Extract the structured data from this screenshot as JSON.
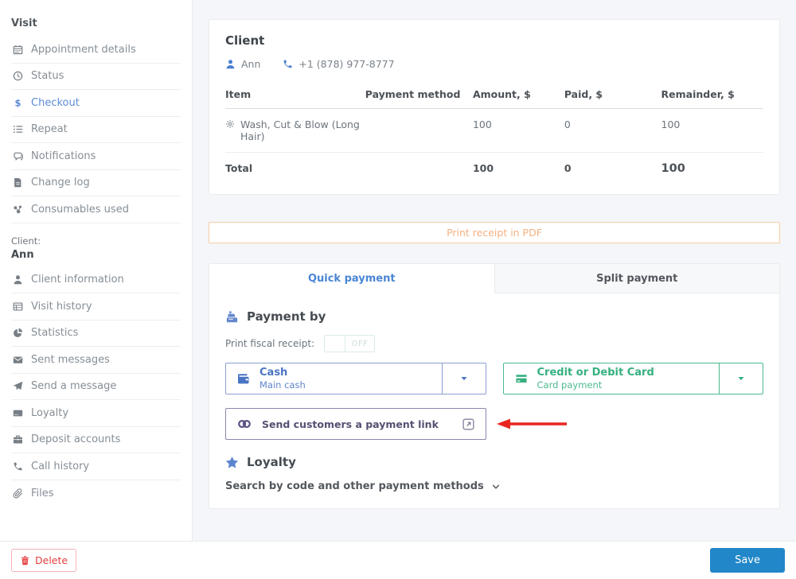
{
  "colors": {
    "active_link_blue": "#5c8bd6",
    "accent_blue": "#4a7fd1",
    "method_blue": "#4a74c4",
    "method_green": "#35b07f",
    "orange_text": "#f5b183",
    "orange_border": "#f6cda5",
    "purple": "#574f73",
    "annotation_red": "#e8251f",
    "save_button_bg": "#2187c8",
    "delete_red": "#e4403f"
  },
  "sidebar": {
    "visit_section": {
      "title": "Visit",
      "items": [
        {
          "label": "Appointment details",
          "icon": "calendar-icon"
        },
        {
          "label": "Status",
          "icon": "clock-icon"
        },
        {
          "label": "Checkout",
          "icon": "dollar-icon",
          "active": true
        },
        {
          "label": "Repeat",
          "icon": "list-icon"
        },
        {
          "label": "Notifications",
          "icon": "chat-icon"
        },
        {
          "label": "Change log",
          "icon": "file-icon"
        },
        {
          "label": "Consumables used",
          "icon": "consumables-icon"
        }
      ]
    },
    "client_section": {
      "label": "Client:",
      "name": "Ann",
      "items": [
        {
          "label": "Client information",
          "icon": "person-icon"
        },
        {
          "label": "Visit history",
          "icon": "table-icon"
        },
        {
          "label": "Statistics",
          "icon": "pie-chart-icon"
        },
        {
          "label": "Sent messages",
          "icon": "envelope-icon"
        },
        {
          "label": "Send a message",
          "icon": "paper-plane-icon"
        },
        {
          "label": "Loyalty",
          "icon": "loyalty-card-icon"
        },
        {
          "label": "Deposit accounts",
          "icon": "briefcase-icon"
        },
        {
          "label": "Call history",
          "icon": "phone-icon"
        },
        {
          "label": "Files",
          "icon": "paperclip-icon"
        }
      ]
    }
  },
  "client_card": {
    "title": "Client",
    "client_name": "Ann",
    "client_phone": "+1 (878) 977-8777",
    "table": {
      "headers": [
        "Item",
        "Payment method",
        "Amount, $",
        "Paid, $",
        "Remainder, $"
      ],
      "rows": [
        {
          "item": "Wash, Cut & Blow (Long Hair)",
          "payment_method": "",
          "amount": "100",
          "paid": "0",
          "remainder": "100"
        }
      ],
      "total": {
        "label": "Total",
        "payment_method": "",
        "amount": "100",
        "paid": "0",
        "remainder": "100"
      }
    }
  },
  "print_receipt_label": "Print receipt in PDF",
  "payment_panel": {
    "tabs": [
      {
        "label": "Quick payment",
        "active": true
      },
      {
        "label": "Split payment",
        "active": false
      }
    ],
    "payment_by_title": "Payment by",
    "fiscal_receipt": {
      "label": "Print fiscal receipt:",
      "state": "OFF"
    },
    "methods": [
      {
        "name": "Cash",
        "sub": "Main cash",
        "icon": "wallet-icon"
      },
      {
        "name": "Credit or Debit Card",
        "sub": "Card payment",
        "icon": "credit-card-icon"
      }
    ],
    "payment_link_label": "Send customers a payment link",
    "loyalty_title": "Loyalty",
    "search_methods_label": "Search by code and other payment methods"
  },
  "footer": {
    "delete_label": "Delete",
    "save_label": "Save"
  },
  "icons": {
    "client_person": "person-icon",
    "client_phone": "phone-icon",
    "service_item": "gear-icon",
    "payment_by": "cash-register-icon",
    "loyalty": "star-icon",
    "payment_link": "chain-link-icon",
    "payment_link_external": "external-link-icon",
    "method_caret": "chevron-down-icon",
    "search_chevron": "chevron-expand-icon",
    "delete": "trash-icon",
    "annotation_arrow": "red-arrow-icon"
  }
}
